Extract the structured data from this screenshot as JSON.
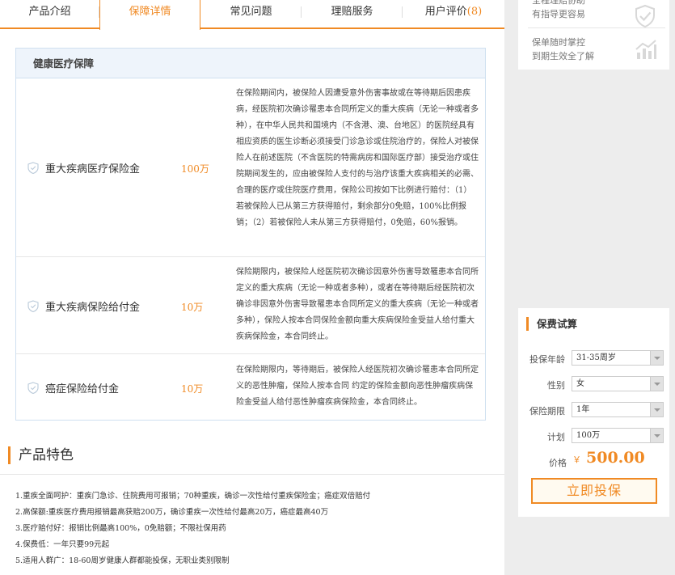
{
  "tabs": [
    {
      "label": "产品介绍"
    },
    {
      "label": "保障详情"
    },
    {
      "label": "常见问题"
    },
    {
      "label": "理赔服务"
    },
    {
      "label": "用户评价",
      "count": "(8)"
    }
  ],
  "coverage": {
    "title": "健康医疗保障",
    "rows": [
      {
        "name": "重大疾病医疗保险金",
        "amount": "100万",
        "desc": "在保险期间内，被保险人因遭受意外伤害事故或在等待期后因患疾病，经医院初次确诊罹患本合同所定义的重大疾病（无论一种或者多种），在中华人民共和国境内（不含港、澳、台地区）的医院经具有相应资质的医生诊断必须接受门诊急诊或住院治疗的，保险人对被保险人在前述医院（不含医院的特需病房和国际医疗部）接受治疗或住院期间发生的，应由被保险人支付的与治疗该重大疾病相关的必需、合理的医疗或住院医疗费用，保险公司按如下比例进行赔付：（1）若被保险人已从第三方获得赔付，剩余部分0免赔，100%比例报销；（2）若被保险人未从第三方获得赔付，0免赔，60%报销。"
      },
      {
        "name": "重大疾病保险给付金",
        "amount": "10万",
        "desc": "保险期限内，被保险人经医院初次确诊因意外伤害导致罹患本合同所定义的重大疾病（无论一种或者多种），或者在等待期后经医院初次确诊非因意外伤害导致罹患本合同所定义的重大疾病（无论一种或者多种），保险人按本合同保险金额向重大疾病保险金受益人给付重大疾病保险金，本合同终止。"
      },
      {
        "name": "癌症保险给付金",
        "amount": "10万",
        "desc": "在保险期限内，等待期后，被保险人经医院初次确诊罹患本合同所定义的恶性肿瘤，保险人按本合同 约定的保险金额向恶性肿瘤疾病保险金受益人给付恶性肿瘤疾病保险金，本合同终止。"
      }
    ]
  },
  "features": {
    "title": "产品特色",
    "items": [
      "1.重疾全面呵护：重疾门急诊、住院费用可报销；70种重疾，确诊一次性给付重疾保险金；癌症双倍赔付",
      "2.高保额:重疾医疗费用报销最高获赔200万，确诊重疾一次性给付最高20万，癌症最高40万",
      "3.医疗赔付好：报销比例最高100%，0免赔额；不限社保用药",
      "4.保费低：一年只要99元起",
      "5.适用人群广：18-60周岁健康人群都能投保，无职业类别限制"
    ]
  },
  "promo": [
    {
      "line1": "全程理赔协助",
      "line2": "有指导更容易",
      "icon": "shield-check-icon"
    },
    {
      "line1": "保单随时掌控",
      "line2": "到期生效全了解",
      "icon": "growth-chart-icon"
    }
  ],
  "calc": {
    "title": "保费试算",
    "fields": [
      {
        "label": "投保年龄",
        "value": "31-35周岁"
      },
      {
        "label": "性别",
        "value": "女"
      },
      {
        "label": "保险期限",
        "value": "1年"
      },
      {
        "label": "计划",
        "value": "100万"
      }
    ],
    "price_label": "价格",
    "currency": "￥",
    "price": "500.00",
    "buy_label": "立即投保"
  },
  "colors": {
    "accent": "#f08a24",
    "border": "#cfe0f0"
  }
}
